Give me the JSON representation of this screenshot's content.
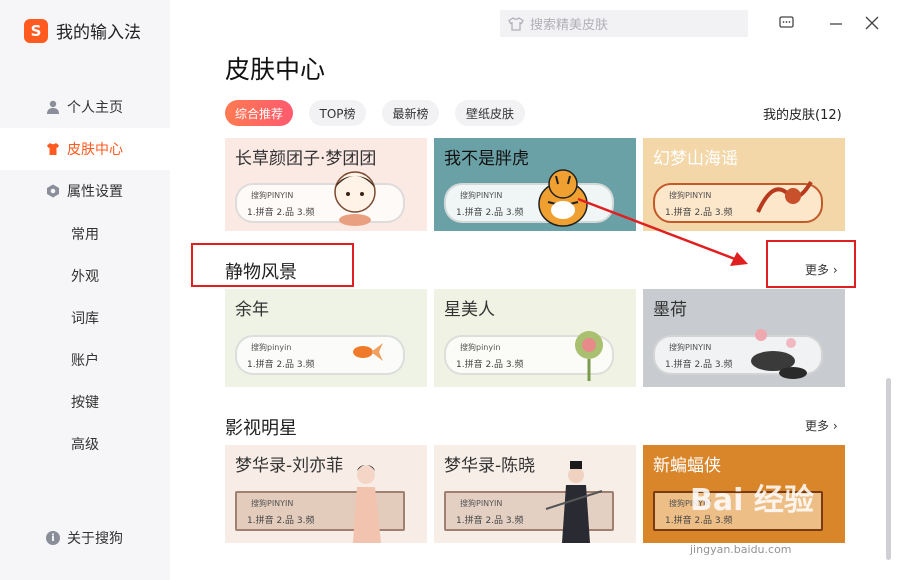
{
  "app": {
    "logo_glyph": "S",
    "title": "我的输入法",
    "accent": "#ff5a1f"
  },
  "sidebar": {
    "items": [
      {
        "label": "个人主页",
        "icon": "person-icon"
      },
      {
        "label": "皮肤中心",
        "icon": "shirt-icon",
        "active": true
      },
      {
        "label": "属性设置",
        "icon": "hexagon-icon"
      }
    ],
    "sub_items": [
      "常用",
      "外观",
      "词库",
      "账户",
      "按键",
      "高级"
    ],
    "about": "关于搜狗"
  },
  "search": {
    "placeholder": "搜索精美皮肤",
    "icon": "skin-shirt-icon"
  },
  "window_controls": [
    "message-icon",
    "minimize-icon",
    "close-icon"
  ],
  "main": {
    "title": "皮肤中心",
    "tabs": [
      "综合推荐",
      "TOP榜",
      "最新榜",
      "壁纸皮肤"
    ],
    "active_tab": "综合推荐",
    "my_skins": "我的皮肤(12)"
  },
  "keyboard_preview": {
    "brand": "搜狗PINYIN",
    "brand_lower": "搜狗pinyin",
    "candidates": "1.拼音  2.品  3.频"
  },
  "top_row": [
    {
      "title": "长草颜团子·梦团团",
      "bg": "#fbe9e4"
    },
    {
      "title": "我不是胖虎",
      "bg": "#6aa1a6"
    },
    {
      "title": "幻梦山海谣",
      "bg": "#f3d7a8"
    }
  ],
  "sections": [
    {
      "title": "静物风景",
      "more": "更多",
      "cards": [
        {
          "title": "余年",
          "bg": "#eef3e6"
        },
        {
          "title": "星美人",
          "bg": "#f0f3e3"
        },
        {
          "title": "墨荷",
          "bg": "#c8cbcf"
        }
      ]
    },
    {
      "title": "影视明星",
      "more": "更多",
      "cards": [
        {
          "title": "梦华录-刘亦菲",
          "bg": "#f7ede6"
        },
        {
          "title": "梦华录-陈晓",
          "bg": "#f7eee8"
        },
        {
          "title": "新蝙蝠侠",
          "bg": "#d9852a"
        }
      ]
    }
  ],
  "watermark": {
    "text": "Bai 经验",
    "sub": "jingyan.baidu.com"
  }
}
